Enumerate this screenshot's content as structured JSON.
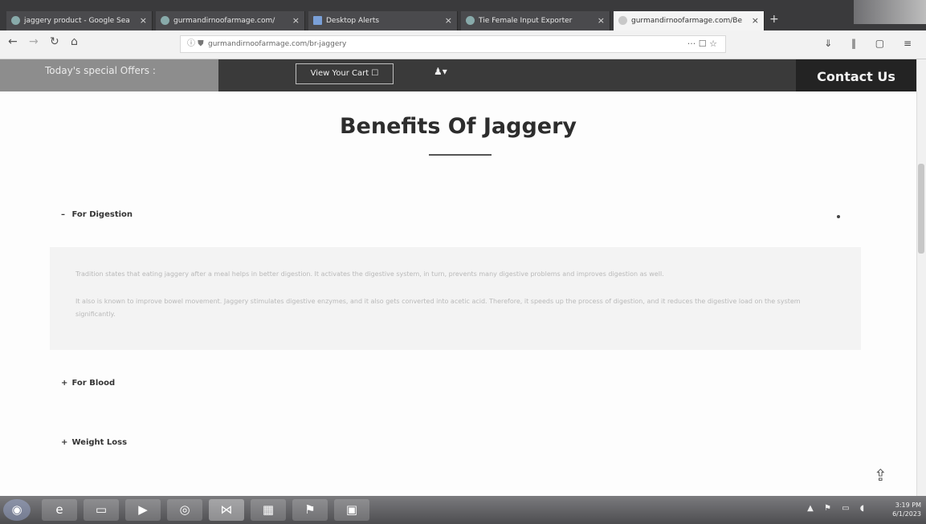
{
  "browser": {
    "tabs": [
      {
        "label": "jaggery product - Google Sea"
      },
      {
        "label": "gurmandirnoofarmage.com/"
      },
      {
        "label": "Desktop Alerts"
      },
      {
        "label": "Tie Female Input Exporter"
      },
      {
        "label": "gurmandirnoofarmage.com/Be"
      }
    ],
    "new_tab": "+",
    "url": "gurmandirnoofarmage.com/br-jaggery",
    "url_right": "··· ☐ ☆",
    "toolbar_icons": "⇓ ‖ ▢ ≡"
  },
  "site_header": {
    "offers": "Today's special Offers :",
    "cart": "View Your Cart ☐",
    "user": "♟▾",
    "contact": "Contact Us"
  },
  "page": {
    "title": "Benefits Of Jaggery",
    "sections": [
      {
        "bullet": "–",
        "label": "For Digestion"
      },
      {
        "bullet": "+",
        "label": "For Blood"
      },
      {
        "bullet": "+",
        "label": "Weight Loss"
      }
    ],
    "panel_lines": [
      "Tradition states that eating jaggery after a meal helps in better digestion. It activates the digestive system, in turn, prevents many digestive problems and improves digestion as well.",
      "It also is known to improve bowel movement. Jaggery stimulates digestive enzymes, and it also gets converted into acetic acid. Therefore, it speeds up the process of digestion, and it reduces the digestive load on the system significantly."
    ]
  },
  "taskbar": {
    "clock_time": "3:19 PM",
    "clock_date": "6/1/2023"
  }
}
